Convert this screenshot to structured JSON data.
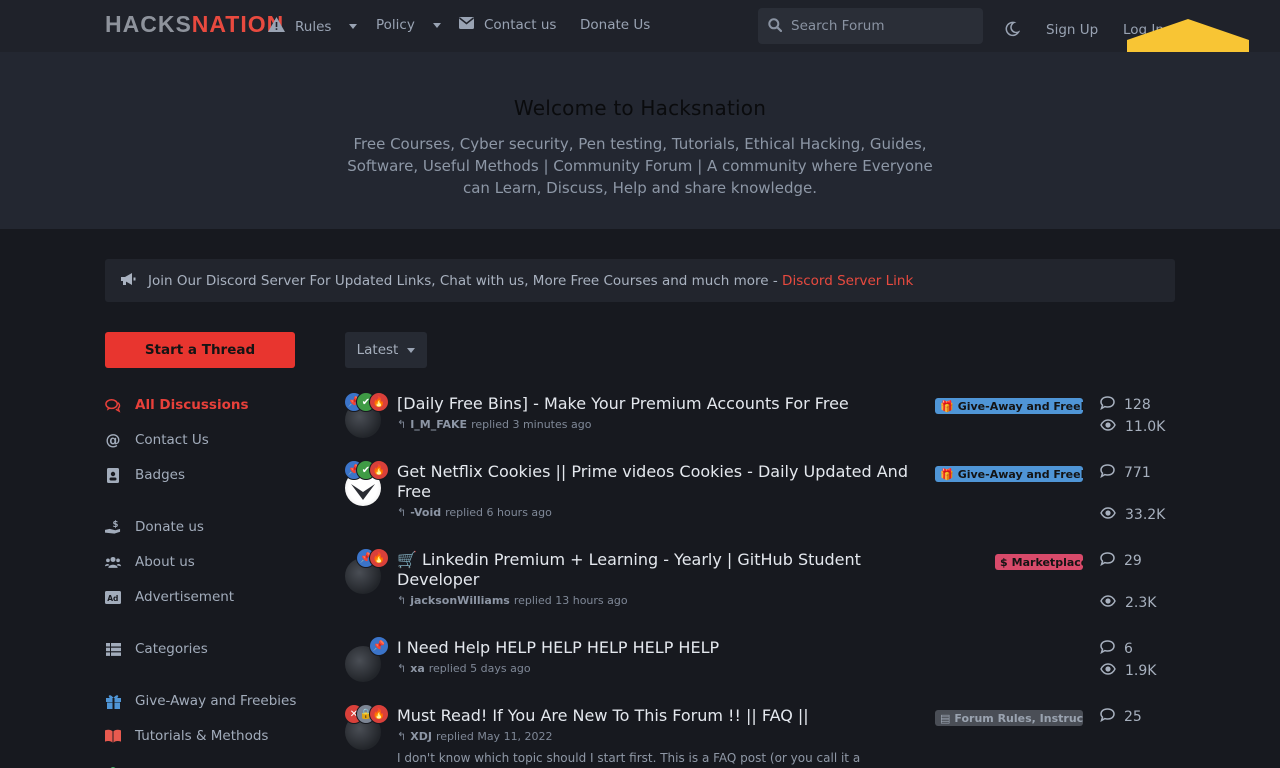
{
  "header": {
    "logo_part1": "HACKS",
    "logo_part2": "NATION",
    "nav": [
      {
        "label": "Rules",
        "icon": "warning-icon"
      },
      {
        "label": "Policy"
      },
      {
        "label": "Contact us",
        "icon": "envelope-icon"
      },
      {
        "label": "Donate Us"
      }
    ],
    "search_placeholder": "Search Forum",
    "signup": "Sign Up",
    "login": "Log In"
  },
  "hero": {
    "title": "Welcome to Hacksnation",
    "description": "Free Courses, Cyber security, Pen testing, Tutorials, Ethical Hacking, Guides, Software, Useful Methods | Community Forum | A community where Everyone can Learn, Discuss, Help and share knowledge."
  },
  "announcement": {
    "text": "Join Our Discord Server For Updated Links, Chat with us, More Free Courses and much more - ",
    "link": "Discord Server Link"
  },
  "sidebar": {
    "start_thread": "Start a Thread",
    "items": [
      {
        "label": "All Discussions",
        "icon": "comments-icon"
      },
      {
        "label": "Contact Us",
        "icon": "at-icon"
      },
      {
        "label": "Badges",
        "icon": "id-badge-icon"
      },
      {
        "label": "Donate us",
        "icon": "donate-hand-icon"
      },
      {
        "label": "About us",
        "icon": "users-icon"
      },
      {
        "label": "Advertisement",
        "icon": "ad-icon"
      },
      {
        "label": "Categories",
        "icon": "list-icon"
      },
      {
        "label": "Give-Away and Freebies",
        "icon": "gift-icon"
      },
      {
        "label": "Tutorials & Methods",
        "icon": "book-icon"
      }
    ]
  },
  "sort": {
    "label": "Latest"
  },
  "discussions": [
    {
      "title": "[Daily Free Bins] - Make Your Premium Accounts For Free",
      "user": "I_M_FAKE",
      "action": "replied 3 minutes ago",
      "tag": "Give-Away and Freebies",
      "replies": "128",
      "views": "11.0K"
    },
    {
      "title": "Get Netflix Cookies || Prime videos Cookies - Daily Updated And Free",
      "user": "-Void",
      "action": "replied 6 hours ago",
      "tag": "Give-Away and Freebies",
      "replies": "771",
      "views": "33.2K"
    },
    {
      "title": "🛒 Linkedin Premium + Learning - Yearly | GitHub Student Developer",
      "user": "jacksonWilliams",
      "action": "replied 13 hours ago",
      "tag": "Marketplace",
      "replies": "29",
      "views": "2.3K"
    },
    {
      "title": "I Need Help HELP HELP HELP HELP HELP",
      "user": "xa",
      "action": "replied 5 days ago",
      "tag": "",
      "replies": "6",
      "views": "1.9K"
    },
    {
      "title": "Must Read! If You Are New To This Forum !! || FAQ ||",
      "user": "XDJ",
      "action": "replied May 11, 2022",
      "tag": "Forum Rules, Instructions",
      "replies": "25",
      "excerpt": "I don't know which topic should I start first. This is a FAQ post (or you call it a"
    }
  ],
  "colors": {
    "accent": "#e8352f",
    "freebies_tag": "#4f95d6",
    "marketplace_tag": "#d84a6a",
    "rules_tag": "#4a4e56"
  }
}
